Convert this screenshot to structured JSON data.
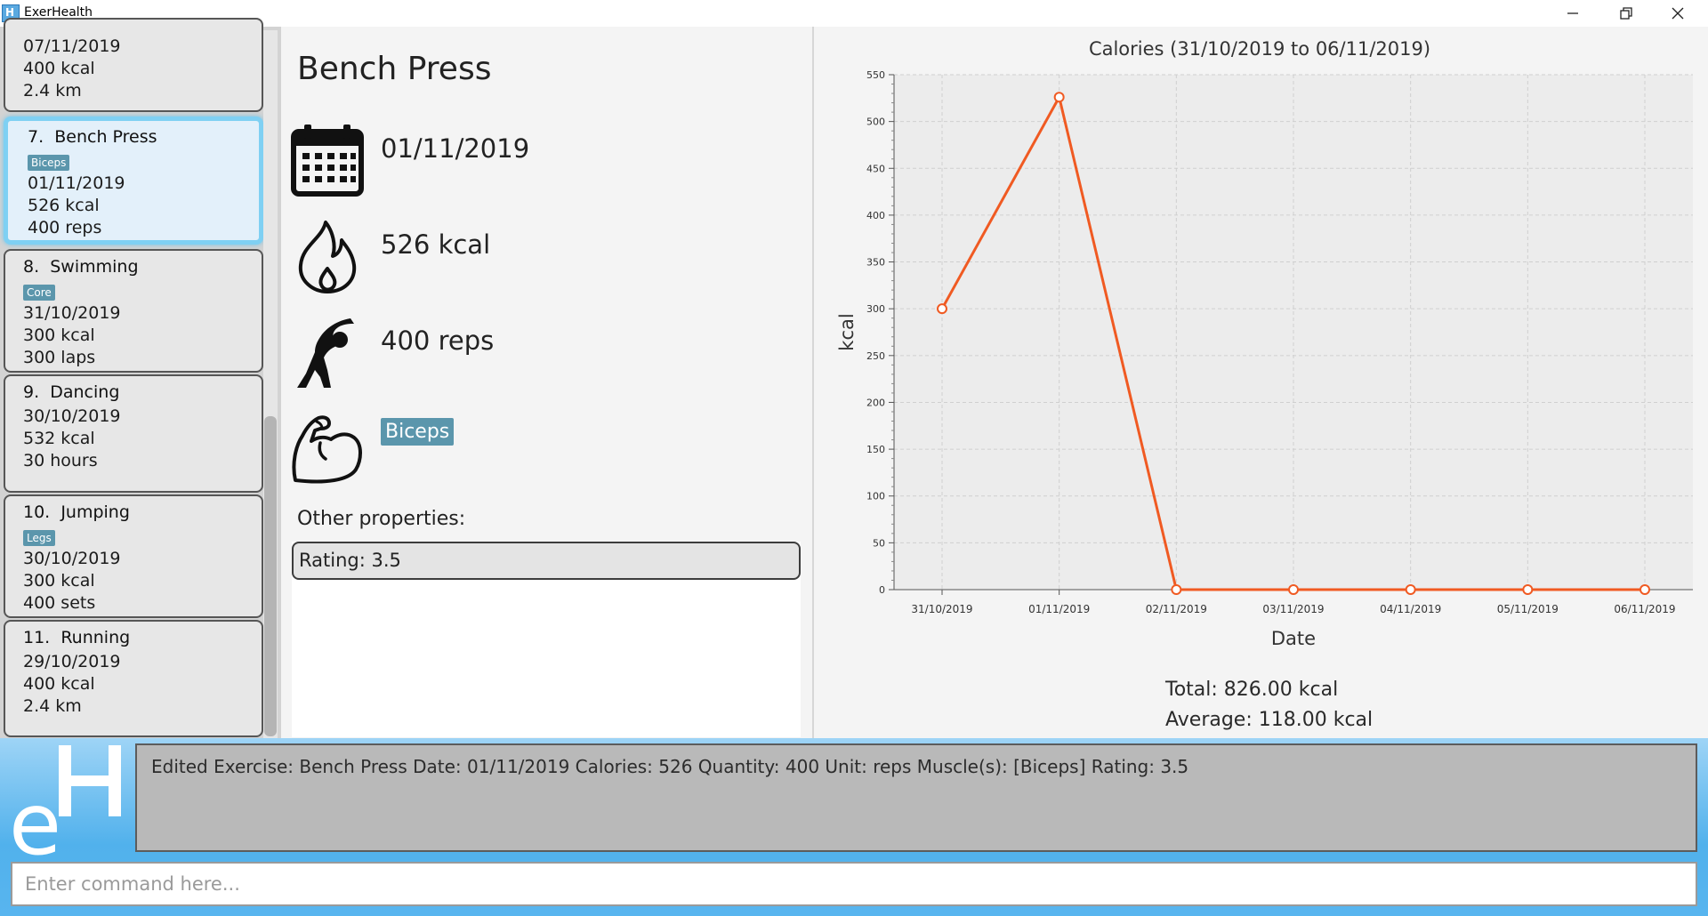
{
  "window": {
    "title": "ExerHealth",
    "app_icon_letter": "H",
    "minimize_icon": "minimize-icon",
    "maximize_icon": "restore-icon",
    "close_icon": "close-icon"
  },
  "exercise_list": {
    "items": [
      {
        "date": "07/11/2019",
        "calories": "400 kcal",
        "quantity": "2.4 km"
      },
      {
        "index": "7.",
        "name": "Bench Press",
        "tag": "Biceps",
        "date": "01/11/2019",
        "calories": "526 kcal",
        "quantity": "400 reps",
        "selected": true
      },
      {
        "index": "8.",
        "name": "Swimming",
        "tag": "Core",
        "date": "31/10/2019",
        "calories": "300 kcal",
        "quantity": "300 laps"
      },
      {
        "index": "9.",
        "name": "Dancing",
        "date": "30/10/2019",
        "calories": "532 kcal",
        "quantity": "30 hours"
      },
      {
        "index": "10.",
        "name": "Jumping",
        "tag": "Legs",
        "date": "30/10/2019",
        "calories": "300 kcal",
        "quantity": "400 sets"
      },
      {
        "index": "11.",
        "name": "Running",
        "date": "29/10/2019",
        "calories": "400 kcal",
        "quantity": "2.4 km"
      }
    ]
  },
  "detail": {
    "title": "Bench Press",
    "date": "01/11/2019",
    "calories": "526 kcal",
    "quantity": "400 reps",
    "muscle": "Biceps",
    "other_properties_label": "Other properties:",
    "property_row": "Rating: 3.5",
    "icons": {
      "date": "calendar-icon",
      "calories": "flame-icon",
      "quantity": "exercise-person-icon",
      "muscle": "flexed-arm-icon"
    }
  },
  "chart_data": {
    "type": "line",
    "title": "Calories (31/10/2019 to 06/11/2019)",
    "xlabel": "Date",
    "ylabel": "kcal",
    "categories": [
      "31/10/2019",
      "01/11/2019",
      "02/11/2019",
      "03/11/2019",
      "04/11/2019",
      "05/11/2019",
      "06/11/2019"
    ],
    "values": [
      300,
      526,
      0,
      0,
      0,
      0,
      0
    ],
    "ylim": [
      0,
      550
    ],
    "yticks": [
      0,
      50,
      100,
      150,
      200,
      250,
      300,
      350,
      400,
      450,
      500,
      550
    ],
    "grid": true,
    "line_color": "#f05a22",
    "plot_background": "#ececec"
  },
  "summary": {
    "total": "Total: 826.00 kcal",
    "average": "Average: 118.00 kcal"
  },
  "result_display": {
    "text": "Edited Exercise: Bench Press Date: 01/11/2019 Calories: 526 Quantity: 400 Unit: reps Muscle(s): [Biceps] Rating: 3.5"
  },
  "command_box": {
    "placeholder": "Enter command here..."
  },
  "logo": {
    "name": "exerhealth-logo",
    "letter": "e"
  }
}
